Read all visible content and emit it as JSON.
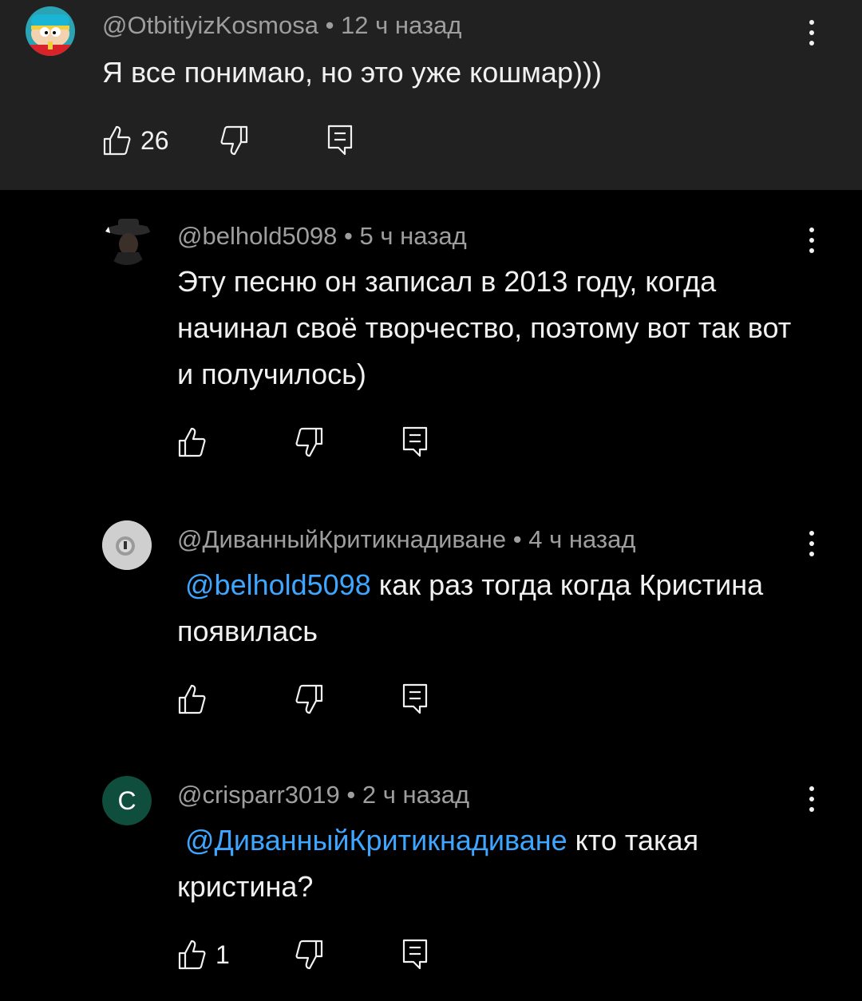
{
  "comments": [
    {
      "author": "@OtbitiyizKosmosa",
      "time": "• 12 ч назад",
      "text": "Я все понимаю, но это уже кошмар)))",
      "likes": "26",
      "avatar": "cartman-avatar"
    },
    {
      "author": "@belhold5098",
      "time": "• 5 ч назад",
      "text": "Эту песню он записал в 2013 году, когда начинал своё творчество, поэтому вот так вот и получилось)",
      "likes": "",
      "avatar": "hat-man-avatar"
    },
    {
      "author": "@ДиванныйКритикнадиване",
      "time": "• 4 ч назад",
      "mention": "@belhold5098",
      "text": "как раз тогда когда Кристина появилась",
      "likes": "",
      "avatar": "lock-avatar"
    },
    {
      "author": "@crisparr3019",
      "time": "• 2 ч назад",
      "mention": "@ДиванныйКритикнадиване",
      "text": "кто такая кристина?",
      "likes": "1",
      "avatar_letter": "C",
      "avatar_color": "#0f4d3c"
    }
  ],
  "colors": {
    "top_bg": "#212121",
    "bg": "#000000",
    "mention": "#3ea6ff",
    "meta": "#9e9e9e"
  },
  "icons": [
    "thumb-up-icon",
    "thumb-down-icon",
    "reply-icon",
    "more-vert-icon"
  ]
}
